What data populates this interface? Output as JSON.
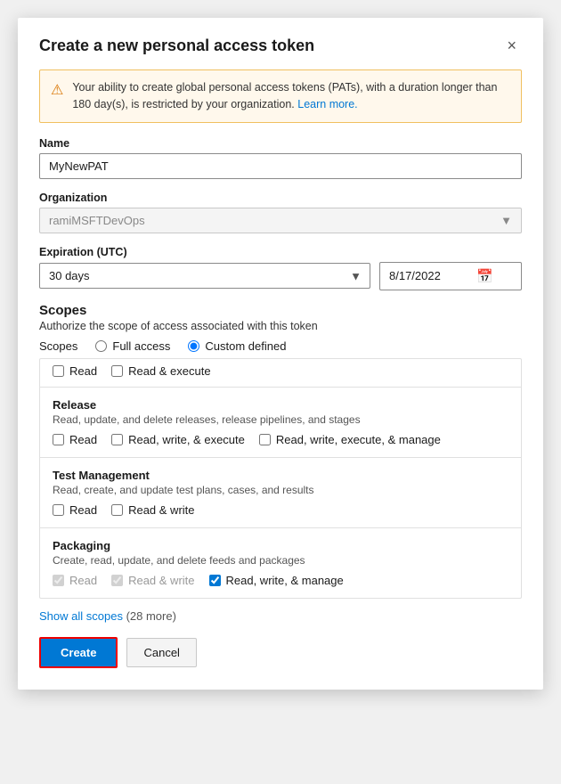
{
  "modal": {
    "title": "Create a new personal access token",
    "close_label": "×"
  },
  "warning": {
    "icon": "⚠",
    "text": "Your ability to create global personal access tokens (PATs), with a duration longer than 180 day(s), is restricted by your organization.",
    "link_text": "Learn more.",
    "link_href": "#"
  },
  "form": {
    "name_label": "Name",
    "name_value": "MyNewPAT",
    "name_placeholder": "MyNewPAT",
    "org_label": "Organization",
    "org_value": "ramiMSFTDevOps",
    "expiry_label": "Expiration (UTC)",
    "expiry_option": "30 days",
    "expiry_date": "8/17/2022"
  },
  "scopes": {
    "title": "Scopes",
    "description": "Authorize the scope of access associated with this token",
    "options_label": "Scopes",
    "full_access_label": "Full access",
    "custom_defined_label": "Custom defined",
    "partial_items": [
      {
        "id": "partial-read",
        "label": "Read",
        "checked": false
      },
      {
        "id": "partial-readexec",
        "label": "Read & execute",
        "checked": false
      }
    ],
    "groups": [
      {
        "id": "release",
        "title": "Release",
        "description": "Read, update, and delete releases, release pipelines, and stages",
        "checkboxes": [
          {
            "id": "rel-read",
            "label": "Read",
            "checked": false,
            "disabled": false
          },
          {
            "id": "rel-readwriteexec",
            "label": "Read, write, & execute",
            "checked": false,
            "disabled": false
          },
          {
            "id": "rel-readwriteexecmanage",
            "label": "Read, write, execute, & manage",
            "checked": false,
            "disabled": false
          }
        ]
      },
      {
        "id": "test-mgmt",
        "title": "Test Management",
        "description": "Read, create, and update test plans, cases, and results",
        "checkboxes": [
          {
            "id": "test-read",
            "label": "Read",
            "checked": false,
            "disabled": false
          },
          {
            "id": "test-readwrite",
            "label": "Read & write",
            "checked": false,
            "disabled": false
          }
        ]
      },
      {
        "id": "packaging",
        "title": "Packaging",
        "description": "Create, read, update, and delete feeds and packages",
        "checkboxes": [
          {
            "id": "pkg-read",
            "label": "Read",
            "checked": true,
            "disabled": true
          },
          {
            "id": "pkg-readwrite",
            "label": "Read & write",
            "checked": true,
            "disabled": true
          },
          {
            "id": "pkg-readwritemanage",
            "label": "Read, write, & manage",
            "checked": true,
            "disabled": false
          }
        ]
      }
    ],
    "show_all_label": "Show all scopes",
    "show_all_count": "(28 more)"
  },
  "footer": {
    "create_label": "Create",
    "cancel_label": "Cancel"
  }
}
